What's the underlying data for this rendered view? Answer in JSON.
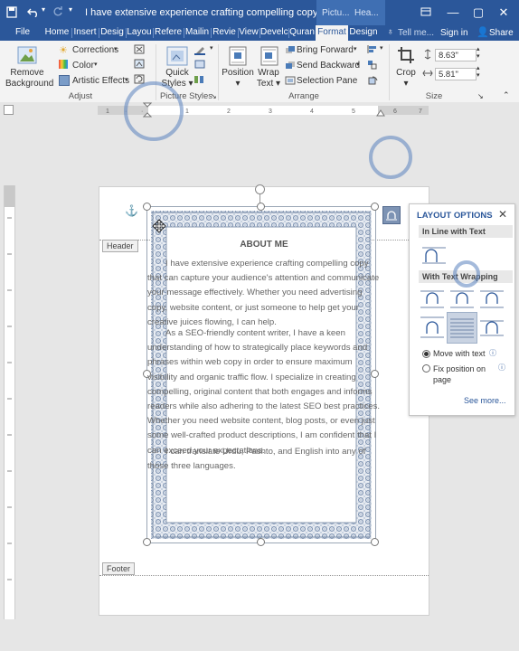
{
  "titlebar": {
    "title": "I have extensive experience crafting compelling copy that can...",
    "ctx1": "Pictu...",
    "ctx2": "Hea..."
  },
  "tabs": [
    "File",
    "Home",
    "Insert",
    "Desig",
    "Layou",
    "Refere",
    "Mailin",
    "Revie",
    "View",
    "Develc",
    "Quran",
    "Format",
    "Design"
  ],
  "tabs_right": {
    "tell": "Tell me...",
    "signin": "Sign in",
    "share": "Share"
  },
  "ribbon": {
    "remove_bg": [
      "Remove",
      "Background"
    ],
    "corrections": "Corrections",
    "color": "Color",
    "artistic": "Artistic Effects",
    "adjust": "Adjust",
    "quick_styles": [
      "Quick",
      "Styles"
    ],
    "picture_styles": "Picture Styles",
    "position": "Position",
    "wrap_text": [
      "Wrap",
      "Text"
    ],
    "bring_forward": "Bring Forward",
    "send_backward": "Send Backward",
    "selection_pane": "Selection Pane",
    "arrange": "Arrange",
    "crop": "Crop",
    "height": "8.63\"",
    "width": "5.81\"",
    "size": "Size"
  },
  "document": {
    "header_tag": "Header",
    "footer_tag": "Footer",
    "heading": "ABOUT ME",
    "p1": "I have extensive experience crafting compelling copy that can capture your audience's attention and communicate your message effectively. Whether you need advertising copy, website content, or just someone to help get your creative juices flowing, I can help.",
    "p2": "As a SEO-friendly content writer, I have a keen understanding of how to strategically place keywords and phrases within web copy in order to ensure maximum visibility and organic traffic flow. I specialize in creating compelling, original content that both engages and informs readers while also adhering to the latest SEO best practices. Whether you need website content, blog posts, or even just some well-crafted product descriptions, I am confident that I can exceed your expectations.",
    "p3": "I can translate Urdu, Pashto, and English into any of those three languages."
  },
  "layout_options": {
    "title": "LAYOUT OPTIONS",
    "inline": "In Line with Text",
    "wrapping": "With Text Wrapping",
    "move_with_text": "Move with text",
    "fix_position": "Fix position on page",
    "see_more": "See more..."
  },
  "colors": {
    "brand": "#2b579a",
    "accent": "#2b579a"
  }
}
